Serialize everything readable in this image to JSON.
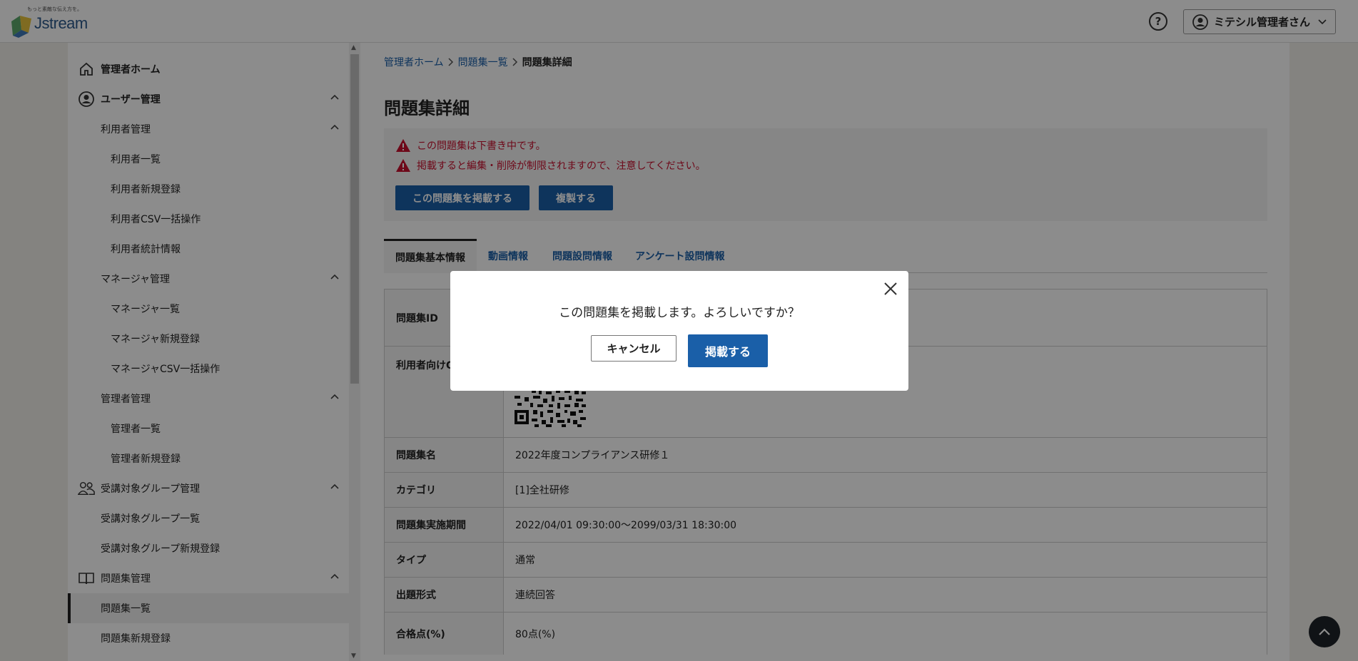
{
  "header": {
    "logo_tagline": "もっと素敵な伝え方を。",
    "logo_word": "Jstream",
    "help_glyph": "?",
    "user_name": "ミテシル管理者さん"
  },
  "sidebar": {
    "items": [
      {
        "label": "管理者ホーム"
      },
      {
        "label": "ユーザー管理"
      },
      {
        "label": "利用者管理"
      },
      {
        "label": "利用者一覧"
      },
      {
        "label": "利用者新規登録"
      },
      {
        "label": "利用者CSV一括操作"
      },
      {
        "label": "利用者統計情報"
      },
      {
        "label": "マネージャ管理"
      },
      {
        "label": "マネージャ一覧"
      },
      {
        "label": "マネージャ新規登録"
      },
      {
        "label": "マネージャCSV一括操作"
      },
      {
        "label": "管理者管理"
      },
      {
        "label": "管理者一覧"
      },
      {
        "label": "管理者新規登録"
      },
      {
        "label": "受講対象グループ管理"
      },
      {
        "label": "受講対象グループ一覧"
      },
      {
        "label": "受講対象グループ新規登録"
      },
      {
        "label": "問題集管理"
      },
      {
        "label": "問題集一覧"
      },
      {
        "label": "問題集新規登録"
      }
    ]
  },
  "breadcrumb": {
    "home": "管理者ホーム",
    "list": "問題集一覧",
    "current": "問題集詳細"
  },
  "page_title": "問題集詳細",
  "notice": {
    "line1": "この問題集は下書き中です。",
    "line2": "掲載すると編集・削除が制限されますので、注意してください。",
    "publish_button": "この問題集を掲載する",
    "copy_button": "複製する"
  },
  "tabs": [
    {
      "label": "問題集基本情報"
    },
    {
      "label": "動画情報"
    },
    {
      "label": "問題設問情報"
    },
    {
      "label": "アンケート設問情報"
    }
  ],
  "table": {
    "rows": [
      {
        "label": "問題集ID",
        "value": ""
      },
      {
        "label": "利用者向けQ",
        "value": ""
      },
      {
        "label": "問題集名",
        "value": "2022年度コンプライアンス研修１"
      },
      {
        "label": "カテゴリ",
        "value": "[1]全社研修"
      },
      {
        "label": "問題集実施期間",
        "value": "2022/04/01 09:30:00～2099/03/31 18:30:00"
      },
      {
        "label": "タイプ",
        "value": "通常"
      },
      {
        "label": "出題形式",
        "value": "連続回答"
      },
      {
        "label": "合格点(%)",
        "value": "80点(%)"
      }
    ]
  },
  "modal": {
    "message": "この問題集を掲載します。よろしいですか？",
    "cancel_label": "キャンセル",
    "confirm_label": "掲載する"
  },
  "colors": {
    "accent": "#1a5fa8",
    "warning": "#c8102e",
    "overlay": "rgba(0,0,0,0.45)"
  }
}
